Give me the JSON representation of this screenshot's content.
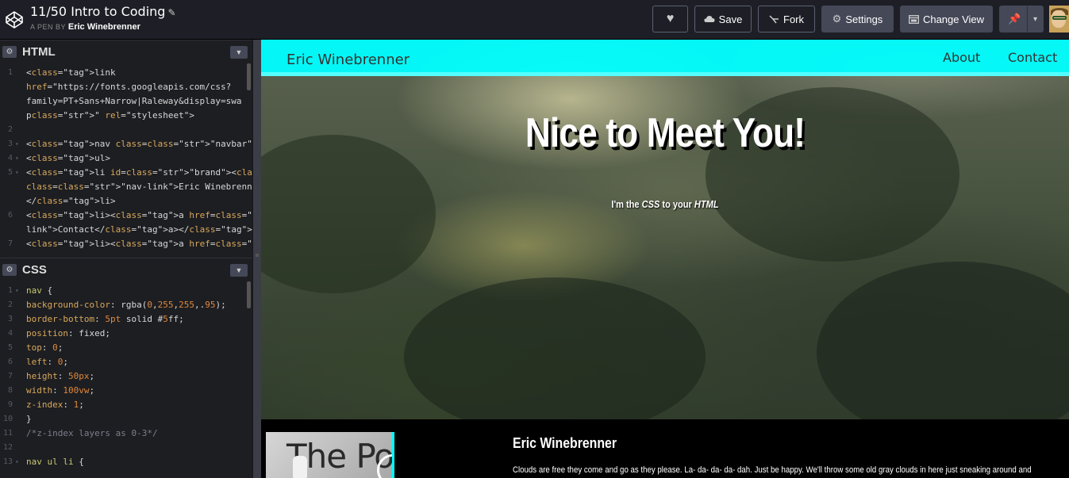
{
  "header": {
    "pen_title": "11/50 Intro to Coding",
    "pen_by_prefix": "A PEN BY",
    "author": "Eric Winebrenner",
    "save_label": "Save",
    "fork_label": "Fork",
    "settings_label": "Settings",
    "change_view_label": "Change View"
  },
  "editors": {
    "html": {
      "name": "HTML",
      "lines": [
        {
          "n": "1",
          "t": "<link"
        },
        {
          "n": "",
          "t": "href=\"https://fonts.googleapis.com/css?"
        },
        {
          "n": "",
          "t": "family=PT+Sans+Narrow|Raleway&display=swa"
        },
        {
          "n": "",
          "t": "p\" rel=\"stylesheet\">"
        },
        {
          "n": "2",
          "t": ""
        },
        {
          "n": "3",
          "t": "<nav class=\"navbar\">"
        },
        {
          "n": "4",
          "t": " <ul>"
        },
        {
          "n": "5",
          "t": "   <li id=\"brand\"><a href=\"#home\""
        },
        {
          "n": "",
          "t": "class=\"nav-link\">Eric Winebrenner</a>"
        },
        {
          "n": "",
          "t": "</li>"
        },
        {
          "n": "6",
          "t": "   <li><a href=\"#contact\" class=\"nav-"
        },
        {
          "n": "",
          "t": "link\">Contact</a></li>"
        },
        {
          "n": "7",
          "t": "   <li><a href=\"#about\" class=\"nav-"
        }
      ]
    },
    "css": {
      "name": "CSS",
      "lines": [
        {
          "n": "1",
          "t": "nav {"
        },
        {
          "n": "2",
          "t": " background-color: rgba(0,255,255,.95);"
        },
        {
          "n": "3",
          "t": " border-bottom: 5pt solid #5ff;"
        },
        {
          "n": "4",
          "t": " position: fixed;"
        },
        {
          "n": "5",
          "t": " top: 0;"
        },
        {
          "n": "6",
          "t": " left: 0;"
        },
        {
          "n": "7",
          "t": " height: 50px;"
        },
        {
          "n": "8",
          "t": " width: 100vw;"
        },
        {
          "n": "9",
          "t": " z-index: 1;"
        },
        {
          "n": "10",
          "t": "}"
        },
        {
          "n": "11",
          "t": "/*z-index layers as 0-3*/"
        },
        {
          "n": "12",
          "t": ""
        },
        {
          "n": "13",
          "t": "nav ul li {"
        }
      ]
    }
  },
  "preview": {
    "brand": "Eric Winebrenner",
    "nav_about": "About",
    "nav_contact": "Contact",
    "hero_title": "Nice to Meet You!",
    "hero_sub_a": "I'm the ",
    "hero_sub_css": "CSS",
    "hero_sub_b": " to your ",
    "hero_sub_html": "HTML",
    "about_sign": "The Po",
    "about_name": "Eric Winebrenner",
    "about_text": "Clouds are free they come and go as they please. La- da- da- da- dah. Just be happy. We'll throw some old gray clouds in here just sneaking around and"
  },
  "colors": {
    "nav_bg": "#00ffff",
    "nav_border": "#55ffff",
    "editor_bg": "#1d1e22",
    "topbar_bg": "#1e1f26"
  }
}
